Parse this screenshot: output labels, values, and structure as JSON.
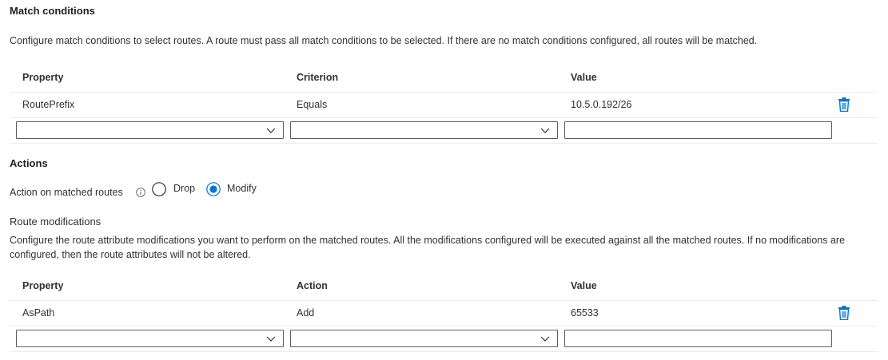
{
  "match_conditions": {
    "title": "Match conditions",
    "description": "Configure match conditions to select routes. A route must pass all match conditions to be selected. If there are no match conditions configured, all routes will be matched.",
    "columns": [
      "Property",
      "Criterion",
      "Value"
    ],
    "rows": [
      {
        "property": "RoutePrefix",
        "criterion": "Equals",
        "value": "10.5.0.192/26"
      }
    ],
    "new_row": {
      "property": "",
      "criterion": "",
      "value": ""
    }
  },
  "actions": {
    "title": "Actions",
    "action_label": "Action on matched routes",
    "options": [
      {
        "label": "Drop",
        "selected": false
      },
      {
        "label": "Modify",
        "selected": true
      }
    ],
    "route_modifications_title": "Route modifications",
    "route_modifications_description": "Configure the route attribute modifications you want to perform on the matched routes. All the modifications configured will be executed against all the matched routes. If no modifications are configured, then the route attributes will not be altered.",
    "columns": [
      "Property",
      "Action",
      "Value"
    ],
    "rows": [
      {
        "property": "AsPath",
        "action": "Add",
        "value": "65533"
      }
    ],
    "new_row": {
      "property": "",
      "action": "",
      "value": ""
    }
  },
  "colors": {
    "accent": "#0078d4",
    "border": "#605e5c",
    "divider": "#edebe9",
    "text": "#323130"
  },
  "icons": {
    "delete": "trash-icon",
    "info": "info-icon",
    "dropdown": "chevron-down-icon"
  }
}
